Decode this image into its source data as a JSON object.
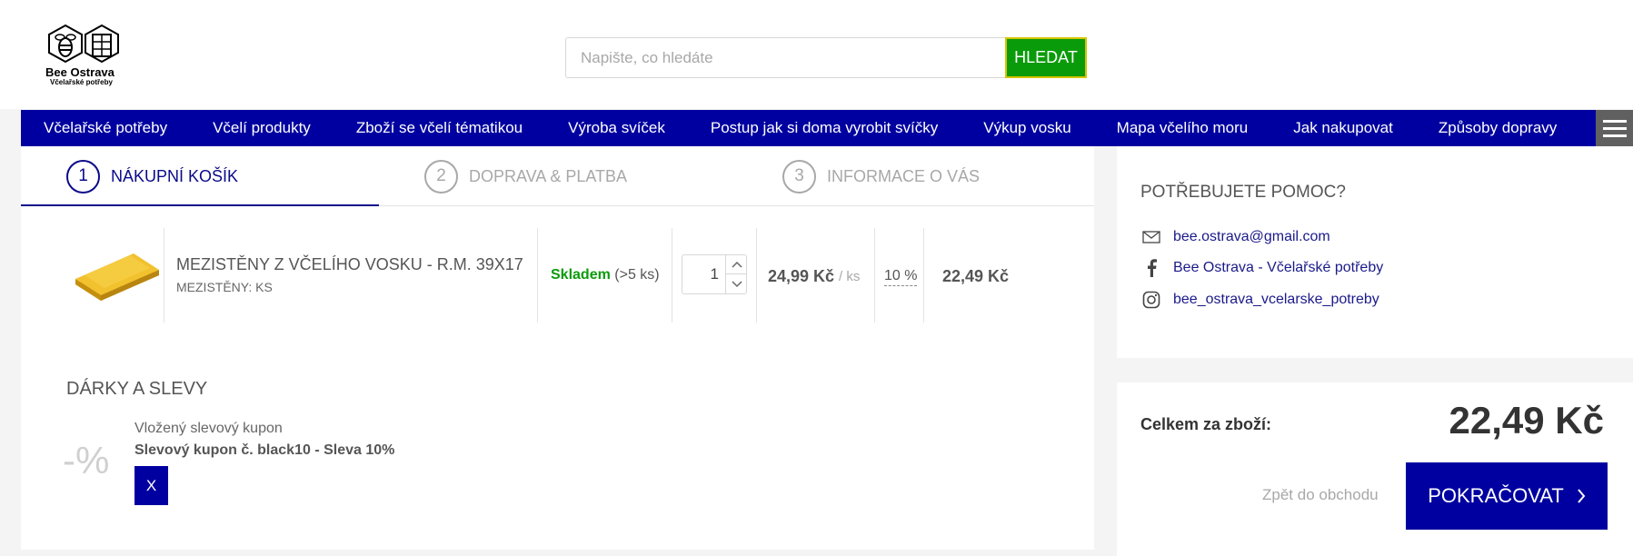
{
  "header": {
    "logo": {
      "name": "Bee Ostrava",
      "subtitle": "Včelařské potřeby"
    },
    "search": {
      "placeholder": "Napište, co hledáte",
      "value": "",
      "button_label": "HLEDAT"
    }
  },
  "nav": {
    "items": [
      "Včelařské potřeby",
      "Včelí produkty",
      "Zboží se včelí tématikou",
      "Výroba svíček",
      "Postup jak si doma vyrobit svíčky",
      "Výkup vosku",
      "Mapa včelího moru",
      "Jak nakupovat",
      "Způsoby dopravy"
    ]
  },
  "steps": [
    {
      "number": "1",
      "label": "NÁKUPNÍ KOŠÍK",
      "active": true
    },
    {
      "number": "2",
      "label": "DOPRAVA & PLATBA",
      "active": false
    },
    {
      "number": "3",
      "label": "INFORMACE O VÁS",
      "active": false
    }
  ],
  "cart": {
    "items": [
      {
        "name": "MEZISTĚNY Z VČELÍHO VOSKU - R.M. 39X17",
        "variant": "MEZISTĚNY: KS",
        "stock_label": "Skladem",
        "stock_qty": "(>5 ks)",
        "quantity": "1",
        "unit_price": "24,99 Kč",
        "unit": "/ ks",
        "discount": "10 %",
        "total": "22,49 Kč"
      }
    ]
  },
  "gifts": {
    "title": "DÁRKY A SLEVY",
    "icon_text": "-%",
    "coupon_label": "Vložený slevový kupon",
    "coupon_name": "Slevový kupon č. black10 - Sleva 10%",
    "remove_label": "X"
  },
  "help": {
    "title": "POTŘEBUJETE POMOC?",
    "email": "bee.ostrava@gmail.com",
    "facebook": "Bee Ostrava - Včelařské potřeby",
    "instagram": "bee_ostrava_vcelarske_potreby"
  },
  "summary": {
    "label": "Celkem za zboží:",
    "value": "22,49 Kč",
    "back_label": "Zpět do obchodu",
    "continue_label": "POKRAČOVAT"
  },
  "colors": {
    "nav_bg": "#0000a0",
    "search_button": "#0a9b0a",
    "stock_green": "#0a9b0a",
    "accent_text": "#1a1a8a"
  }
}
